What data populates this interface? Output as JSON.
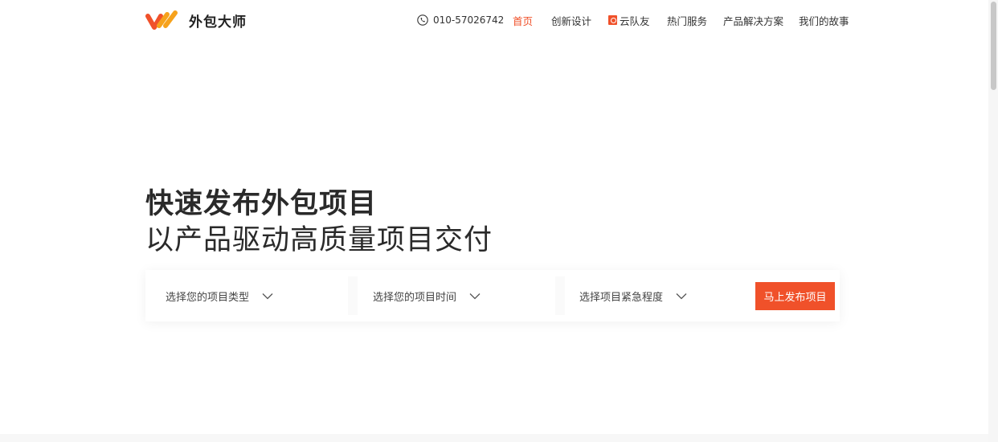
{
  "brand": {
    "name": "外包大师",
    "accent": "#f0512a",
    "accent2": "#f6a21c"
  },
  "nav": {
    "phone": "010-57026742",
    "items": [
      {
        "label": "首页",
        "active": true
      },
      {
        "label": "创新设计"
      },
      {
        "label": "云队友",
        "icon": "badge-icon"
      },
      {
        "label": "热门服务"
      },
      {
        "label": "产品解决方案"
      },
      {
        "label": "我们的故事"
      }
    ]
  },
  "hero": {
    "title": "快速发布外包项目",
    "subtitle": "以产品驱动高质量项目交付"
  },
  "search": {
    "type_placeholder": "选择您的项目类型",
    "time_placeholder": "选择您的项目时间",
    "urgency_placeholder": "选择项目紧急程度",
    "submit_label": "马上发布项目"
  }
}
